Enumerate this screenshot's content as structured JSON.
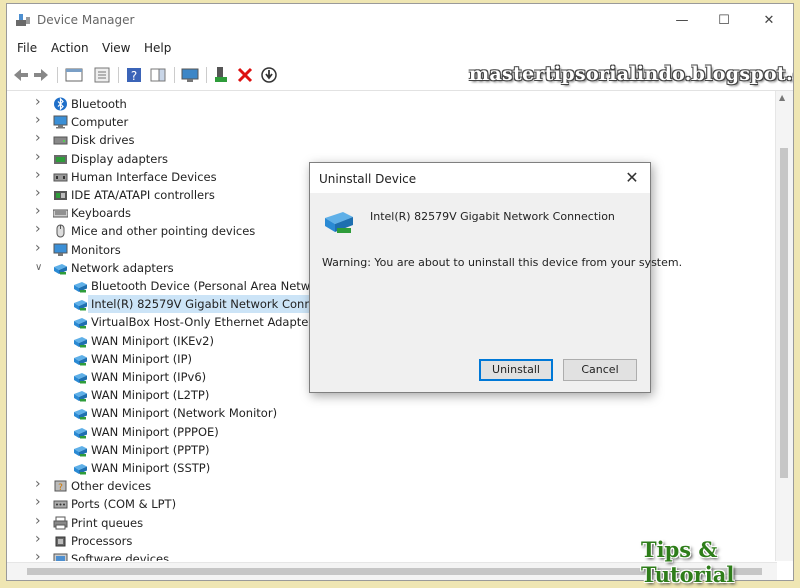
{
  "window": {
    "title": "Device Manager"
  },
  "menu": [
    "File",
    "Action",
    "View",
    "Help"
  ],
  "watermark": "mastertipsorialindo.blogspot.com",
  "tree": [
    {
      "label": "Bluetooth",
      "icon": "bluetooth-icon",
      "level": 0,
      "state": "collapsed"
    },
    {
      "label": "Computer",
      "icon": "computer-icon",
      "level": 0,
      "state": "collapsed"
    },
    {
      "label": "Disk drives",
      "icon": "disk-drive-icon",
      "level": 0,
      "state": "collapsed"
    },
    {
      "label": "Display adapters",
      "icon": "display-adapter-icon",
      "level": 0,
      "state": "collapsed"
    },
    {
      "label": "Human Interface Devices",
      "icon": "hid-icon",
      "level": 0,
      "state": "collapsed"
    },
    {
      "label": "IDE ATA/ATAPI controllers",
      "icon": "ide-controller-icon",
      "level": 0,
      "state": "collapsed"
    },
    {
      "label": "Keyboards",
      "icon": "keyboard-icon",
      "level": 0,
      "state": "collapsed"
    },
    {
      "label": "Mice and other pointing devices",
      "icon": "mouse-icon",
      "level": 0,
      "state": "collapsed"
    },
    {
      "label": "Monitors",
      "icon": "monitor-icon",
      "level": 0,
      "state": "collapsed"
    },
    {
      "label": "Network adapters",
      "icon": "network-adapter-icon",
      "level": 0,
      "state": "expanded"
    },
    {
      "label": "Bluetooth Device (Personal Area Network)",
      "icon": "network-adapter-icon",
      "level": 1
    },
    {
      "label": "Intel(R) 82579V Gigabit Network Connection",
      "icon": "network-adapter-icon",
      "level": 1,
      "selected": true
    },
    {
      "label": "VirtualBox Host-Only Ethernet Adapter",
      "icon": "network-adapter-icon",
      "level": 1
    },
    {
      "label": "WAN Miniport (IKEv2)",
      "icon": "network-adapter-icon",
      "level": 1
    },
    {
      "label": "WAN Miniport (IP)",
      "icon": "network-adapter-icon",
      "level": 1
    },
    {
      "label": "WAN Miniport (IPv6)",
      "icon": "network-adapter-icon",
      "level": 1
    },
    {
      "label": "WAN Miniport (L2TP)",
      "icon": "network-adapter-icon",
      "level": 1
    },
    {
      "label": "WAN Miniport (Network Monitor)",
      "icon": "network-adapter-icon",
      "level": 1
    },
    {
      "label": "WAN Miniport (PPPOE)",
      "icon": "network-adapter-icon",
      "level": 1
    },
    {
      "label": "WAN Miniport (PPTP)",
      "icon": "network-adapter-icon",
      "level": 1
    },
    {
      "label": "WAN Miniport (SSTP)",
      "icon": "network-adapter-icon",
      "level": 1
    },
    {
      "label": "Other devices",
      "icon": "other-device-icon",
      "level": 0,
      "state": "collapsed"
    },
    {
      "label": "Ports (COM & LPT)",
      "icon": "port-icon",
      "level": 0,
      "state": "collapsed"
    },
    {
      "label": "Print queues",
      "icon": "printer-icon",
      "level": 0,
      "state": "collapsed"
    },
    {
      "label": "Processors",
      "icon": "processor-icon",
      "level": 0,
      "state": "collapsed"
    },
    {
      "label": "Software devices",
      "icon": "software-device-icon",
      "level": 0,
      "state": "collapsed"
    }
  ],
  "dialog": {
    "title": "Uninstall Device",
    "device_name": "Intel(R) 82579V Gigabit Network Connection",
    "warning": "Warning: You are about to uninstall this device from your system.",
    "uninstall_label": "Uninstall",
    "cancel_label": "Cancel"
  },
  "logo": "Tips & Tutorial",
  "colors": {
    "selection": "#cce4f7",
    "accent": "#0078d7",
    "icon_blue": "#2a8ad4",
    "icon_green": "#2e9c3a"
  }
}
